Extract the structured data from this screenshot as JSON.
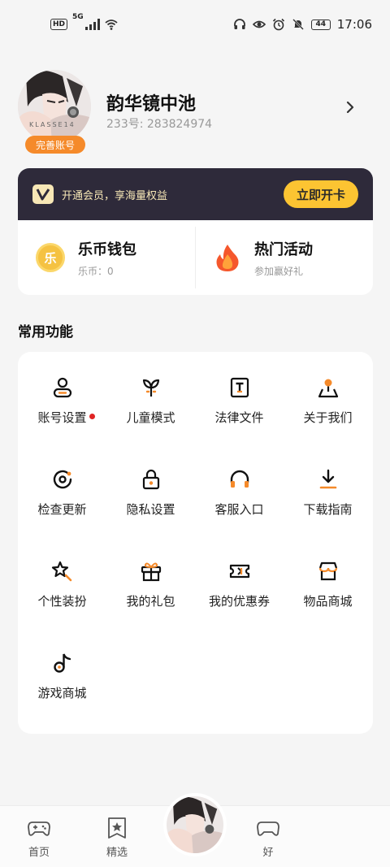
{
  "status_bar": {
    "hd": "HD",
    "network": "5G",
    "battery": "44",
    "time": "17:06"
  },
  "profile": {
    "avatar_text": "KLASSE14",
    "badge": "完善账号",
    "name": "韵华镜中池",
    "id": "233号: 283824974"
  },
  "vip": {
    "text": "开通会员，享海量权益",
    "button": "立即开卡"
  },
  "wallet": {
    "coin_glyph": "乐",
    "coin_title": "乐币钱包",
    "coin_sub": "乐币：0",
    "event_title": "热门活动",
    "event_sub": "参加赢好礼"
  },
  "features": {
    "title": "常用功能",
    "items": [
      {
        "label": "账号设置",
        "icon": "user-icon"
      },
      {
        "label": "儿童模式",
        "icon": "sprout-icon"
      },
      {
        "label": "法律文件",
        "icon": "document-icon"
      },
      {
        "label": "关于我们",
        "icon": "location-pin-icon"
      },
      {
        "label": "检查更新",
        "icon": "refresh-icon"
      },
      {
        "label": "隐私设置",
        "icon": "lock-icon"
      },
      {
        "label": "客服入口",
        "icon": "headphones-icon"
      },
      {
        "label": "下载指南",
        "icon": "download-icon"
      },
      {
        "label": "个性装扮",
        "icon": "magic-star-icon"
      },
      {
        "label": "我的礼包",
        "icon": "gift-icon"
      },
      {
        "label": "我的优惠券",
        "icon": "ticket-icon"
      },
      {
        "label": "物品商城",
        "icon": "shop-icon"
      },
      {
        "label": "游戏商城",
        "icon": "tiktok-note-icon"
      }
    ]
  },
  "bottom_nav": {
    "home": "首页",
    "featured": "精选",
    "partial": "好"
  },
  "colors": {
    "accent": "#f58a2a",
    "vip_bg": "#2e2a3a",
    "vip_btn": "#fcc432",
    "gold_text": "#f7e7b6",
    "red_dot": "#e02424"
  }
}
